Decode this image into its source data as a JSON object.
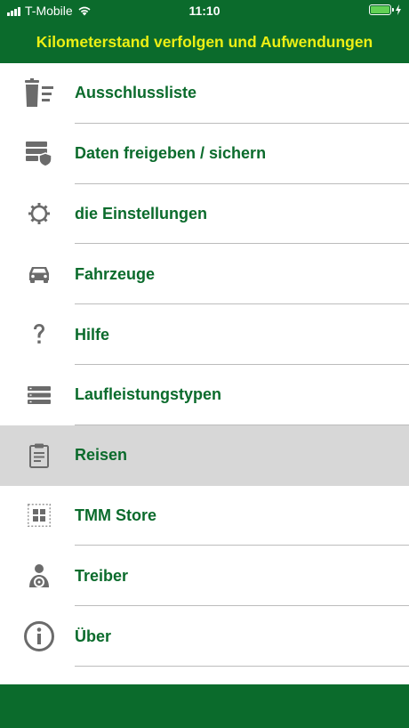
{
  "status_bar": {
    "carrier": "T-Mobile",
    "time": "11:10",
    "signal_bars": 4,
    "battery_level": 1.0,
    "charging": true
  },
  "header": {
    "title": "Kilometerstand verfolgen und Aufwendungen"
  },
  "menu": {
    "items": [
      {
        "label": "Ausschlussliste",
        "icon": "trash-list-icon"
      },
      {
        "label": "Daten freigeben / sichern",
        "icon": "data-shield-icon"
      },
      {
        "label": "die Einstellungen",
        "icon": "gear-icon"
      },
      {
        "label": "Fahrzeuge",
        "icon": "car-icon"
      },
      {
        "label": "Hilfe",
        "icon": "question-icon"
      },
      {
        "label": "Laufleistungstypen",
        "icon": "list-rows-icon"
      },
      {
        "label": "Reisen",
        "icon": "clipboard-icon",
        "selected": true
      },
      {
        "label": "TMM Store",
        "icon": "store-grid-icon"
      },
      {
        "label": "Treiber",
        "icon": "driver-icon"
      },
      {
        "label": "Über",
        "icon": "info-icon"
      }
    ]
  },
  "colors": {
    "brand_green": "#0b6b2c",
    "title_yellow": "#ecef14",
    "icon_gray": "#6b6b6b",
    "selected_bg": "#d7d7d7"
  }
}
